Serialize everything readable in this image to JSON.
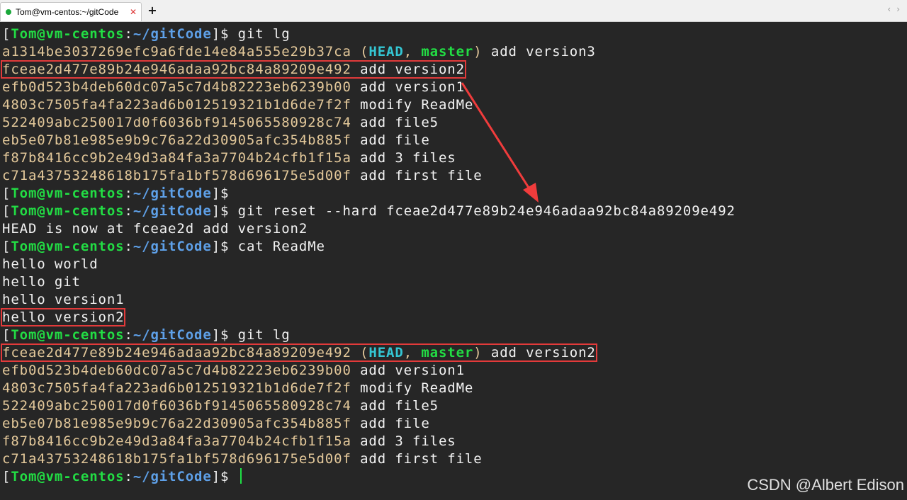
{
  "window": {
    "tab_title": "Tom@vm-centos:~/gitCode",
    "tab_close": "✕",
    "new_tab": "+",
    "nav_left": "‹",
    "nav_right": "›"
  },
  "prompt": {
    "open": "[",
    "user": "Tom@vm-centos",
    "colon": ":",
    "path": "~/gitCode",
    "close": "]$"
  },
  "colors": {
    "background": "#262626",
    "text": "#f2f2f2",
    "hash": "#e3c89a",
    "prompt_user": "#22dd44",
    "prompt_path": "#5ea0e8",
    "head_ref": "#34c6d3",
    "branch_ref": "#22dd44",
    "highlight_box": "#e23a3a",
    "arrow": "#f03c3c",
    "tab_dot": "#1aa83a",
    "cursor": "#1fe045"
  },
  "lines": [
    {
      "type": "prompt",
      "cmd": " git lg"
    },
    {
      "type": "commit",
      "hash": "a1314be3037269efc9a6fde14e84a555e29b37ca",
      "head": "HEAD",
      "branch": "master",
      "msg": " add version3"
    },
    {
      "type": "commit",
      "hash": "fceae2d477e89b24e946adaa92bc84a89209e492",
      "msg": " add version2",
      "highlight": true
    },
    {
      "type": "commit",
      "hash": "efb0d523b4deb60dc07a5c7d4b82223eb6239b00",
      "msg": " add version1"
    },
    {
      "type": "commit",
      "hash": "4803c7505fa4fa223ad6b012519321b1d6de7f2f",
      "msg": " modify ReadMe"
    },
    {
      "type": "commit",
      "hash": "522409abc250017d0f6036bf9145065580928c74",
      "msg": " add file5"
    },
    {
      "type": "commit",
      "hash": "eb5e07b81e985e9b9c76a22d30905afc354b885f",
      "msg": " add file"
    },
    {
      "type": "commit",
      "hash": "f87b8416cc9b2e49d3a84fa3a7704b24cfb1f15a",
      "msg": " add 3 files"
    },
    {
      "type": "commit",
      "hash": "c71a43753248618b175fa1bf578d696175e5d00f",
      "msg": " add first file"
    },
    {
      "type": "prompt",
      "cmd": ""
    },
    {
      "type": "prompt",
      "cmd": " git reset --hard fceae2d477e89b24e946adaa92bc84a89209e492"
    },
    {
      "type": "text",
      "text": "HEAD is now at fceae2d add version2"
    },
    {
      "type": "prompt",
      "cmd": " cat ReadMe"
    },
    {
      "type": "text",
      "text": "hello world"
    },
    {
      "type": "text",
      "text": "hello git"
    },
    {
      "type": "text",
      "text": "hello version1"
    },
    {
      "type": "text",
      "text": "hello version2",
      "highlight": true
    },
    {
      "type": "prompt",
      "cmd": " git lg"
    },
    {
      "type": "commit",
      "hash": "fceae2d477e89b24e946adaa92bc84a89209e492",
      "head": "HEAD",
      "branch": "master",
      "msg": " add version2",
      "highlight": true
    },
    {
      "type": "commit",
      "hash": "efb0d523b4deb60dc07a5c7d4b82223eb6239b00",
      "msg": " add version1"
    },
    {
      "type": "commit",
      "hash": "4803c7505fa4fa223ad6b012519321b1d6de7f2f",
      "msg": " modify ReadMe"
    },
    {
      "type": "commit",
      "hash": "522409abc250017d0f6036bf9145065580928c74",
      "msg": " add file5"
    },
    {
      "type": "commit",
      "hash": "eb5e07b81e985e9b9c76a22d30905afc354b885f",
      "msg": " add file"
    },
    {
      "type": "commit",
      "hash": "f87b8416cc9b2e49d3a84fa3a7704b24cfb1f15a",
      "msg": " add 3 files"
    },
    {
      "type": "commit",
      "hash": "c71a43753248618b175fa1bf578d696175e5d00f",
      "msg": " add first file"
    },
    {
      "type": "prompt",
      "cmd": " ",
      "cursor": true
    }
  ],
  "watermark": "CSDN @Albert Edison"
}
